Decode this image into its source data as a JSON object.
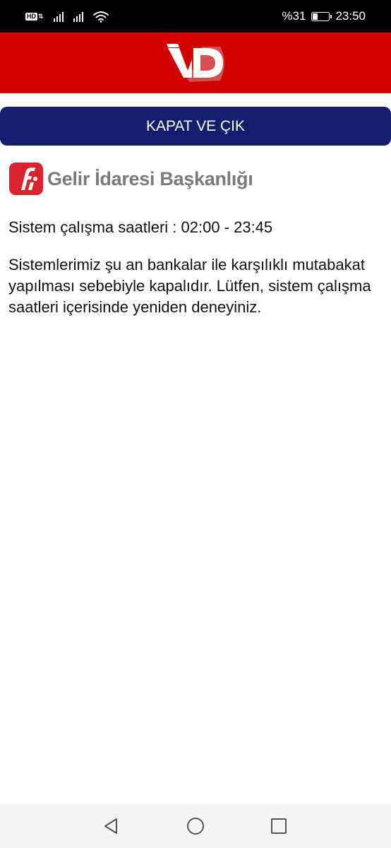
{
  "status_bar": {
    "battery_text": "%31",
    "battery_level": 0.31,
    "time": "23:50",
    "network_badge": "HD",
    "icons": [
      "hd-icon",
      "signal-icon",
      "signal-icon",
      "wifi-icon",
      "battery-icon"
    ]
  },
  "header": {
    "logo_icon": "ivd-logo",
    "background_color": "#d30000"
  },
  "close_button": {
    "label": "KAPAT VE ÇIK",
    "color": "#131f6e"
  },
  "brand": {
    "logo_icon": "gib-logo",
    "name": "Gelir İdaresi Başkanlığı"
  },
  "content": {
    "hours": "Sistem çalışma saatleri : 02:00 - 23:45",
    "message": "Sistemlerimiz şu an bankalar ile karşılıklı mutabakat yapılması sebebiyle kapalıdır. Lütfen, sistem çalışma saatleri içerisinde yeniden deneyiniz."
  },
  "nav_bar": {
    "back_icon": "back-triangle-icon",
    "home_icon": "home-circle-icon",
    "recents_icon": "recents-square-icon"
  }
}
